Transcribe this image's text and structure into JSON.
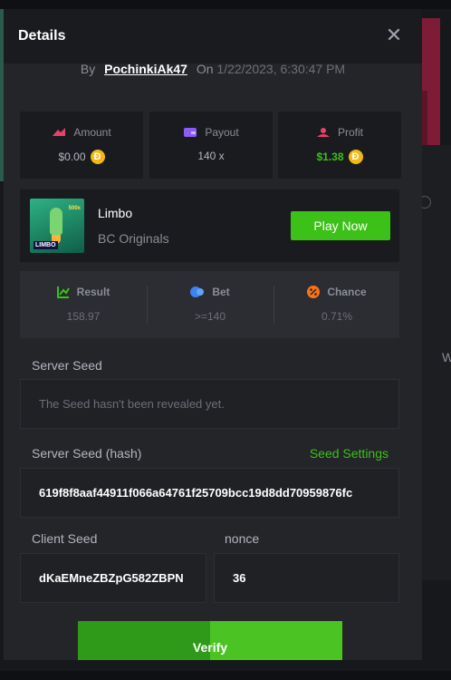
{
  "modal": {
    "title": "Details",
    "close_icon": "close-icon"
  },
  "byline": {
    "by": "By",
    "username": "PochinkiAk47",
    "on": "On",
    "date": "1/22/2023, 6:30:47 PM"
  },
  "stats": {
    "amount": {
      "label": "Amount",
      "value": "$0.00",
      "icon": "amount-icon",
      "color": "#e8426b"
    },
    "payout": {
      "label": "Payout",
      "value": "140 x",
      "icon": "wallet-icon",
      "color": "#8b5cf6"
    },
    "profit": {
      "label": "Profit",
      "value": "$1.38",
      "icon": "profit-icon",
      "color": "#e8426b"
    },
    "coin_symbol": "Ð"
  },
  "game": {
    "name": "Limbo",
    "provider": "BC Originals",
    "thumb_tag": "LIMBO",
    "thumb_mult": "500x",
    "play_label": "Play Now"
  },
  "result": {
    "result": {
      "label": "Result",
      "value": "158.97",
      "icon": "chart-icon"
    },
    "bet": {
      "label": "Bet",
      "value": ">=140",
      "icon": "bet-icon"
    },
    "chance": {
      "label": "Chance",
      "value": "0.71%",
      "icon": "chance-icon"
    }
  },
  "server_seed": {
    "label": "Server Seed",
    "value": "The Seed hasn't been revealed yet."
  },
  "server_seed_hash": {
    "label": "Server Seed (hash)",
    "settings_label": "Seed Settings",
    "value": "619f8f8aaf44911f066a64761f25709bcc19d8dd70959876fc"
  },
  "client_seed": {
    "label": "Client Seed",
    "value": "dKaEMneZBZpG582ZBPN"
  },
  "nonce": {
    "label": "nonce",
    "value": "36"
  },
  "verify_label": "Verify",
  "background": {
    "side_label": "W"
  },
  "colors": {
    "accent_green": "#3bc117",
    "coin_gold": "#f5b813",
    "modal_bg": "#232529"
  }
}
